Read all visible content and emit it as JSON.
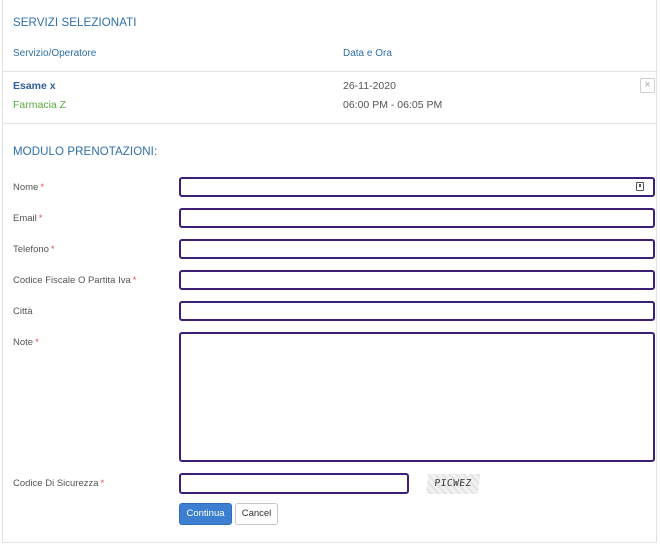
{
  "selected_services": {
    "title": "SERVIZI SELEZIONATI",
    "col_service": "Servizio/Operatore",
    "col_datetime": "Data e Ora",
    "item": {
      "service": "Esame x",
      "operator": "Farmacia Z",
      "date": "26-11-2020",
      "time": "06:00 PM - 06:05 PM",
      "remove_icon": "close-icon"
    }
  },
  "form": {
    "title": "MODULO PRENOTAZIONI:",
    "required_mark": "*",
    "fields": {
      "nome": {
        "label": "Nome",
        "value": ""
      },
      "email": {
        "label": "Email",
        "value": ""
      },
      "telefono": {
        "label": "Telefono",
        "value": ""
      },
      "codice_fiscale": {
        "label": "Codice Fiscale O Partita Iva",
        "value": ""
      },
      "citta": {
        "label": "Città",
        "value": ""
      },
      "note": {
        "label": "Note",
        "value": ""
      },
      "captcha": {
        "label": "Codice Di Sicurezza",
        "value": "",
        "image_text": "PICWEZ"
      }
    },
    "buttons": {
      "submit": "Continua",
      "cancel": "Cancel"
    }
  },
  "colors": {
    "accent": "#2d6fa8",
    "operator": "#56a93c",
    "field_border": "#3d1f78",
    "required": "#d9534f",
    "primary_button": "#3c7fd0"
  }
}
